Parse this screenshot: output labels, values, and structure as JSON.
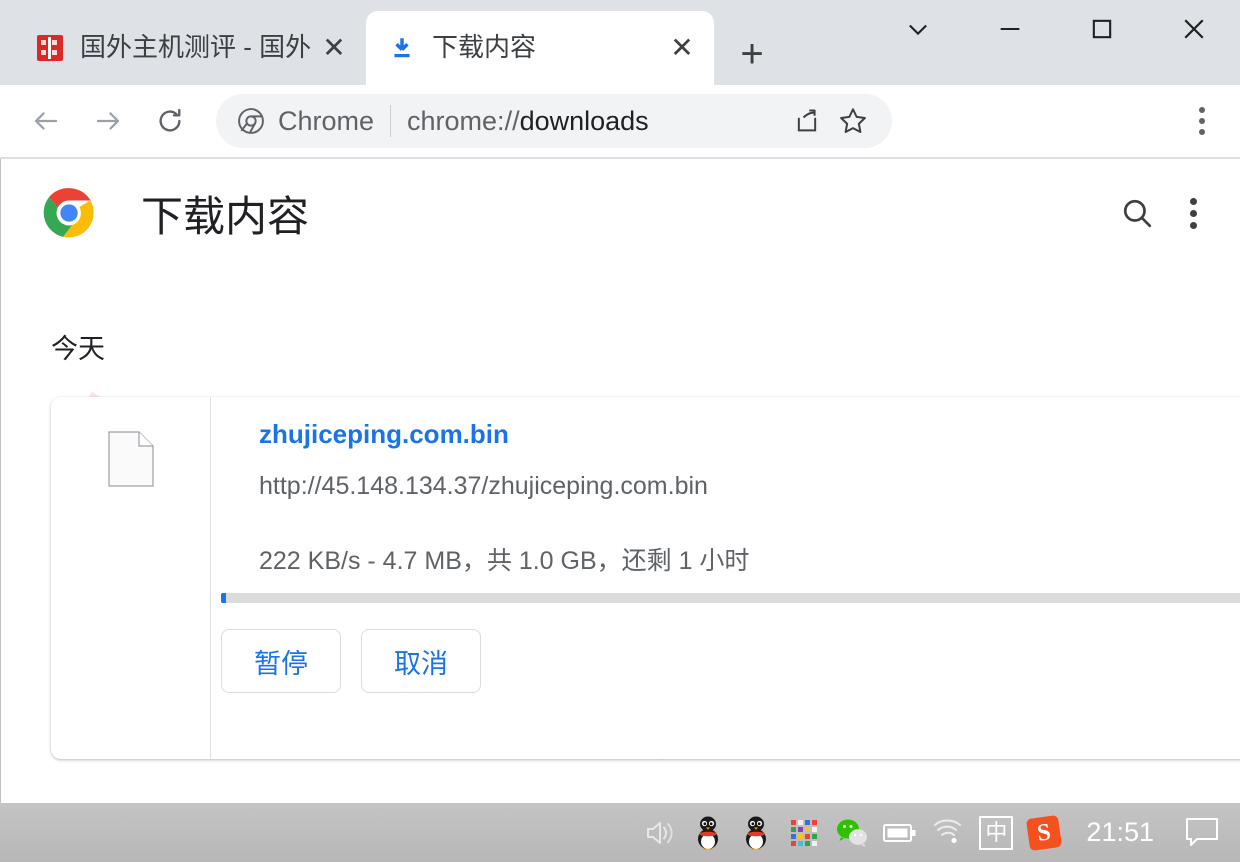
{
  "window": {
    "controls": [
      {
        "name": "tab-search",
        "icon": "chevron-down-icon"
      },
      {
        "name": "minimize",
        "icon": "minimize-icon"
      },
      {
        "name": "maximize",
        "icon": "maximize-icon"
      },
      {
        "name": "close",
        "icon": "close-icon"
      }
    ]
  },
  "tabs": [
    {
      "title": "国外主机测评 - 国外",
      "favicon": "red-square-favicon",
      "active": false,
      "close_label": "✕"
    },
    {
      "title": "下载内容",
      "favicon": "download-arrow-icon",
      "active": true,
      "close_label": "✕"
    }
  ],
  "new_tab_label": "+",
  "toolbar": {
    "back_icon": "back-arrow-icon",
    "forward_icon": "forward-arrow-icon",
    "reload_icon": "reload-icon",
    "omnibox": {
      "chrome_icon": "chrome-logo-icon",
      "label": "Chrome",
      "scheme": "chrome://",
      "path": "downloads",
      "share_icon": "share-icon",
      "bookmark_icon": "star-icon"
    },
    "menu_icon": "three-dots-vertical-icon"
  },
  "downloads_page": {
    "logo": "chrome-logo-icon",
    "title": "下载内容",
    "search_icon": "search-icon",
    "menu_icon": "three-dots-vertical-icon",
    "date_group": "今天",
    "watermark": "zhujiceping.com",
    "item": {
      "file_icon": "generic-file-icon",
      "file_name": "zhujiceping.com.bin",
      "url": "http://45.148.134.37/zhujiceping.com.bin",
      "status": "222 KB/s - 4.7 MB，共 1.0 GB，还剩 1 小时",
      "progress_percent": 0.47,
      "pause_label": "暂停",
      "cancel_label": "取消"
    }
  },
  "taskbar": {
    "clock": "21:51",
    "tray": [
      {
        "name": "volume-icon"
      },
      {
        "name": "qq-icon"
      },
      {
        "name": "qq-icon-2"
      },
      {
        "name": "color-grid-icon"
      },
      {
        "name": "wechat-icon"
      },
      {
        "name": "battery-icon"
      },
      {
        "name": "wifi-icon"
      },
      {
        "name": "ime-chinese-icon",
        "label": "中"
      },
      {
        "name": "sogou-icon",
        "label": "S"
      }
    ],
    "action_center_icon": "notification-icon"
  },
  "colors": {
    "accent_blue": "#1a73e8",
    "chrome_frame": "#dee1e6",
    "watermark_pink": "#fde3e3",
    "taskbar_gray": "#bdbdbd"
  }
}
